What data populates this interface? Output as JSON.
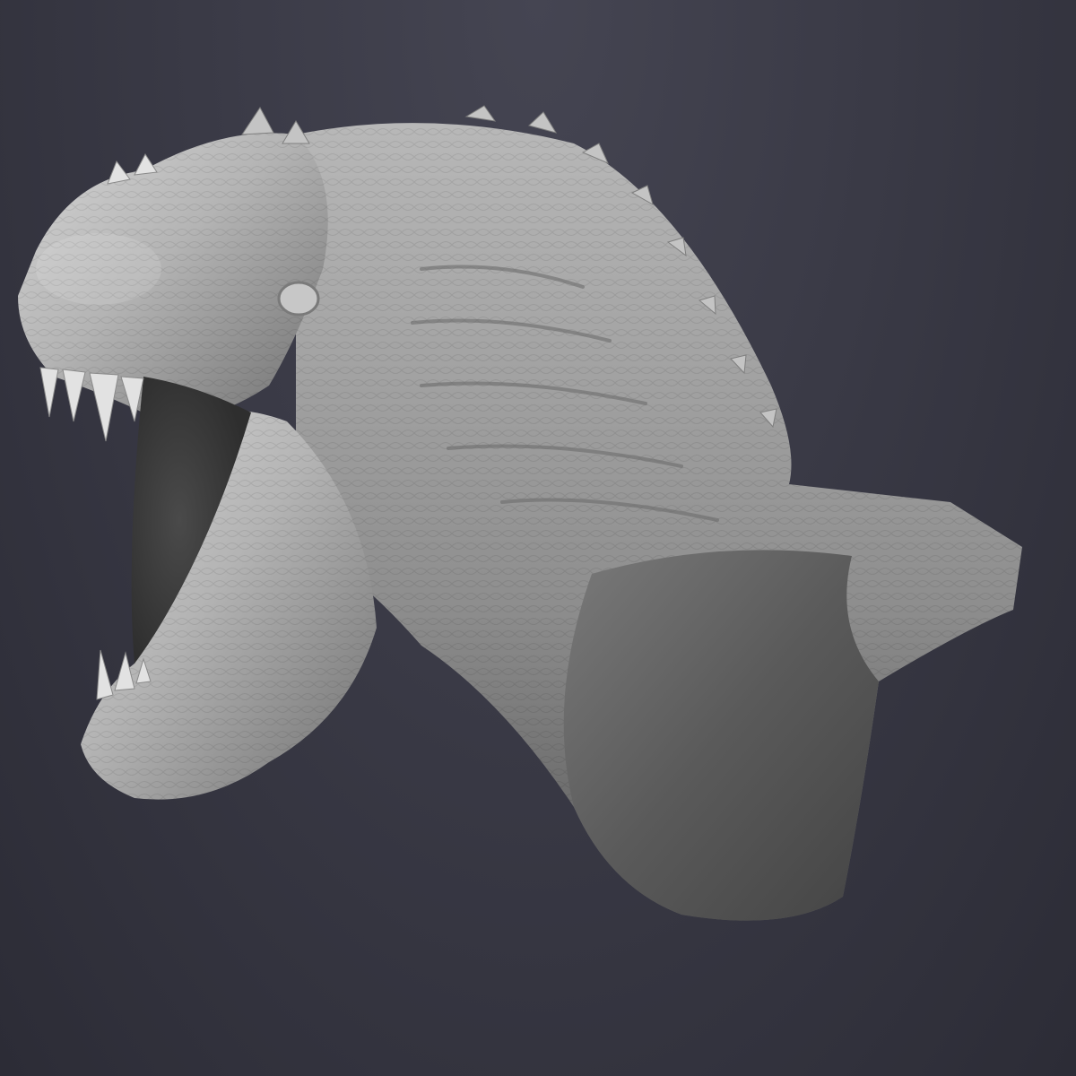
{
  "viewport": {
    "background_color": "#383844",
    "subject": "sculpted-dinosaur-head-bust",
    "material_color": "#b9b9b9"
  }
}
